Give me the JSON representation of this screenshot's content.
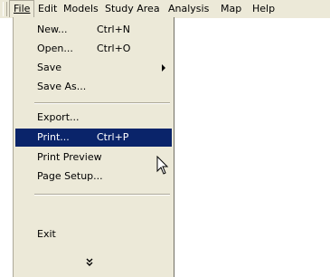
{
  "menubar": {
    "items": [
      {
        "label": "File"
      },
      {
        "label": "Edit"
      },
      {
        "label": "Models"
      },
      {
        "label": "Study Area"
      },
      {
        "label": "Analysis"
      },
      {
        "label": "Map"
      },
      {
        "label": "Help"
      }
    ]
  },
  "file_menu": {
    "items": [
      {
        "label": "New...",
        "shortcut": "Ctrl+N"
      },
      {
        "label": "Open...",
        "shortcut": "Ctrl+O"
      },
      {
        "label": "Save"
      },
      {
        "label": "Save As..."
      },
      {
        "label": "Export..."
      },
      {
        "label": "Print...",
        "shortcut": "Ctrl+P",
        "highlighted": true
      },
      {
        "label": "Print Preview"
      },
      {
        "label": "Page Setup..."
      },
      {
        "label": "Exit"
      }
    ],
    "expand_glyph": "»"
  },
  "icons": {
    "submenu_arrow": "triangle-right-icon",
    "expand": "double-chevron-down-icon",
    "cursor": "mouse-pointer-icon"
  },
  "colors": {
    "menu_bg": "#ece9d8",
    "highlight_bg": "#0a246a",
    "highlight_fg": "#ffffff"
  }
}
